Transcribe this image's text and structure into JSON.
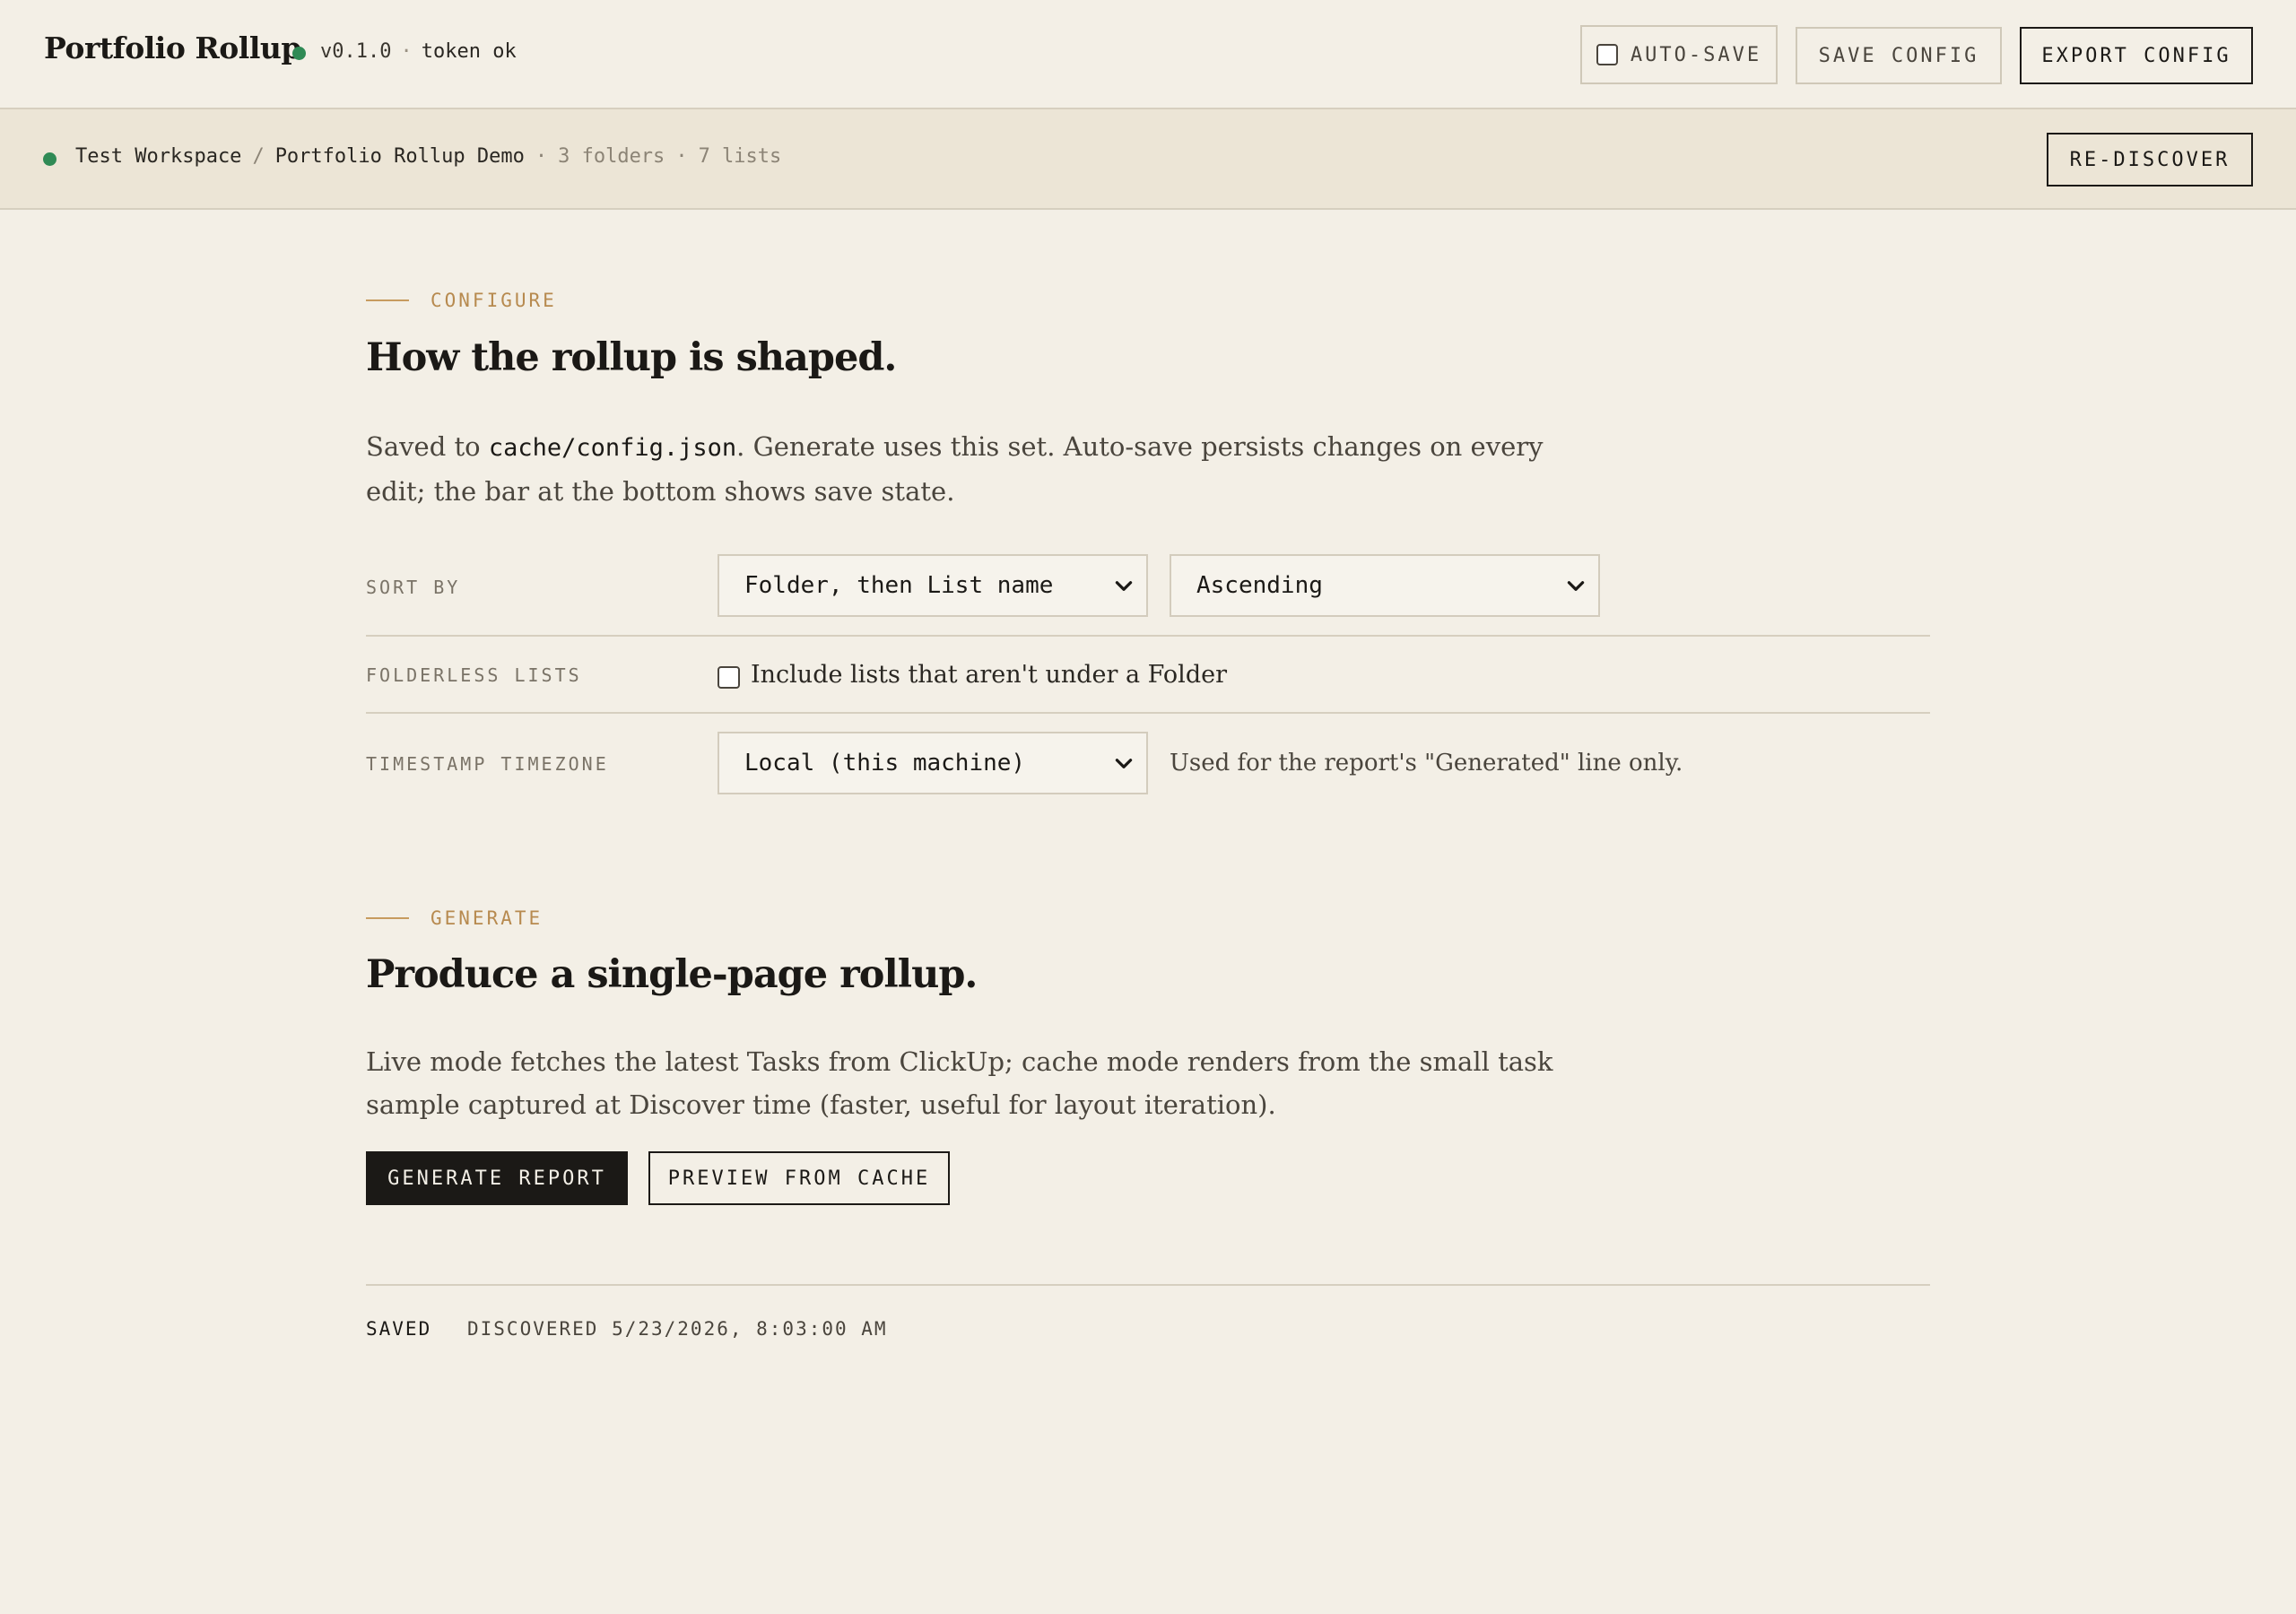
{
  "header": {
    "title": "Portfolio Rollup",
    "version": "v0.1.0",
    "separator": "·",
    "token_status": "token ok",
    "status_color": "#2f8a55",
    "autosave_label": "AUTO-SAVE",
    "autosave_checked": false,
    "save_label": "SAVE CONFIG",
    "export_label": "EXPORT CONFIG"
  },
  "workspace": {
    "name": "Test Workspace",
    "path_separator": "/",
    "space": "Portfolio Rollup Demo",
    "separator": "·",
    "folders": "3 folders",
    "lists": "7 lists",
    "rediscover_label": "RE-DISCOVER"
  },
  "configure": {
    "tag": "CONFIGURE",
    "heading": "How the rollup is shaped.",
    "desc_before": "Saved to ",
    "desc_code": "cache/config.json",
    "desc_after": ". Generate uses this set. Auto-save persists changes on every edit; the bar at the bottom shows save state.",
    "sort_label": "SORT BY",
    "sort_field": "Folder, then List name",
    "sort_order": "Ascending",
    "folderless_label": "FOLDERLESS LISTS",
    "folderless_text": "Include lists that aren't under a Folder",
    "folderless_checked": false,
    "timezone_label": "TIMESTAMP TIMEZONE",
    "timezone_value": "Local (this machine)",
    "timezone_note": "Used for the report's \"Generated\" line only."
  },
  "generate": {
    "tag": "GENERATE",
    "heading": "Produce a single-page rollup.",
    "desc": "Live mode fetches the latest Tasks from ClickUp; cache mode renders from the small task sample captured at Discover time (faster, useful for layout iteration).",
    "generate_label": "GENERATE REPORT",
    "preview_label": "PREVIEW FROM CACHE"
  },
  "footer": {
    "save_state": "SAVED",
    "discovered": "DISCOVERED 5/23/2026, 8:03:00 AM"
  },
  "colors": {
    "background": "#f3efe6",
    "accent": "#b78a4f",
    "ink": "#1b1916"
  }
}
